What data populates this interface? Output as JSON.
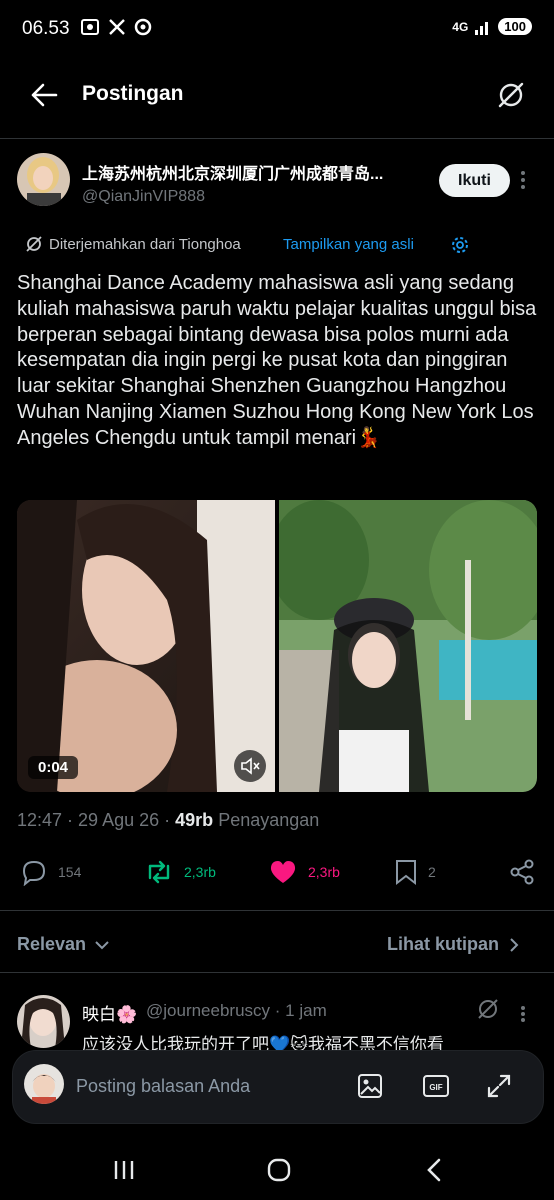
{
  "status_bar": {
    "time": "06.53",
    "network": "4G",
    "battery": "100"
  },
  "header": {
    "title": "Postingan"
  },
  "author": {
    "name": "上海苏州杭州北京深圳厦门广州成都青岛...",
    "handle": "@QianJinVIP888",
    "follow_label": "Ikuti"
  },
  "translation": {
    "note": "Diterjemahkan dari Tionghoa",
    "show_original": "Tampilkan yang asli"
  },
  "tweet": {
    "text": "Shanghai Dance Academy mahasiswa asli yang sedang kuliah mahasiswa paruh waktu pelajar kualitas unggul bisa berperan sebagai bintang dewasa bisa polos murni ada kesempatan dia ingin pergi ke pusat kota dan pinggiran luar sekitar Shanghai Shenzhen Guangzhou Hangzhou Wuhan Nanjing Xiamen Suzhou Hong Kong New York Los Angeles Chengdu untuk tampil menari💃"
  },
  "media": {
    "video_duration": "0:04"
  },
  "meta": {
    "time": "12:47",
    "date": "29 Agu 26",
    "views": "49rb",
    "views_label": "Penayangan"
  },
  "actions": {
    "replies": "154",
    "reposts": "2,3rb",
    "likes": "2,3rb",
    "bookmarks": "2"
  },
  "colors": {
    "repost": "#00ba7c",
    "like": "#f91880",
    "link": "#1d9bf0"
  },
  "sort": {
    "relevant": "Relevan",
    "quotes": "Lihat kutipan"
  },
  "reply": {
    "name": "映白🌸",
    "handle": "@journeebruscy",
    "time": "1 jam",
    "text": "应该没人比我玩的开了吧💙🐱我福不黑不信你看"
  },
  "compose": {
    "placeholder": "Posting balasan Anda"
  }
}
